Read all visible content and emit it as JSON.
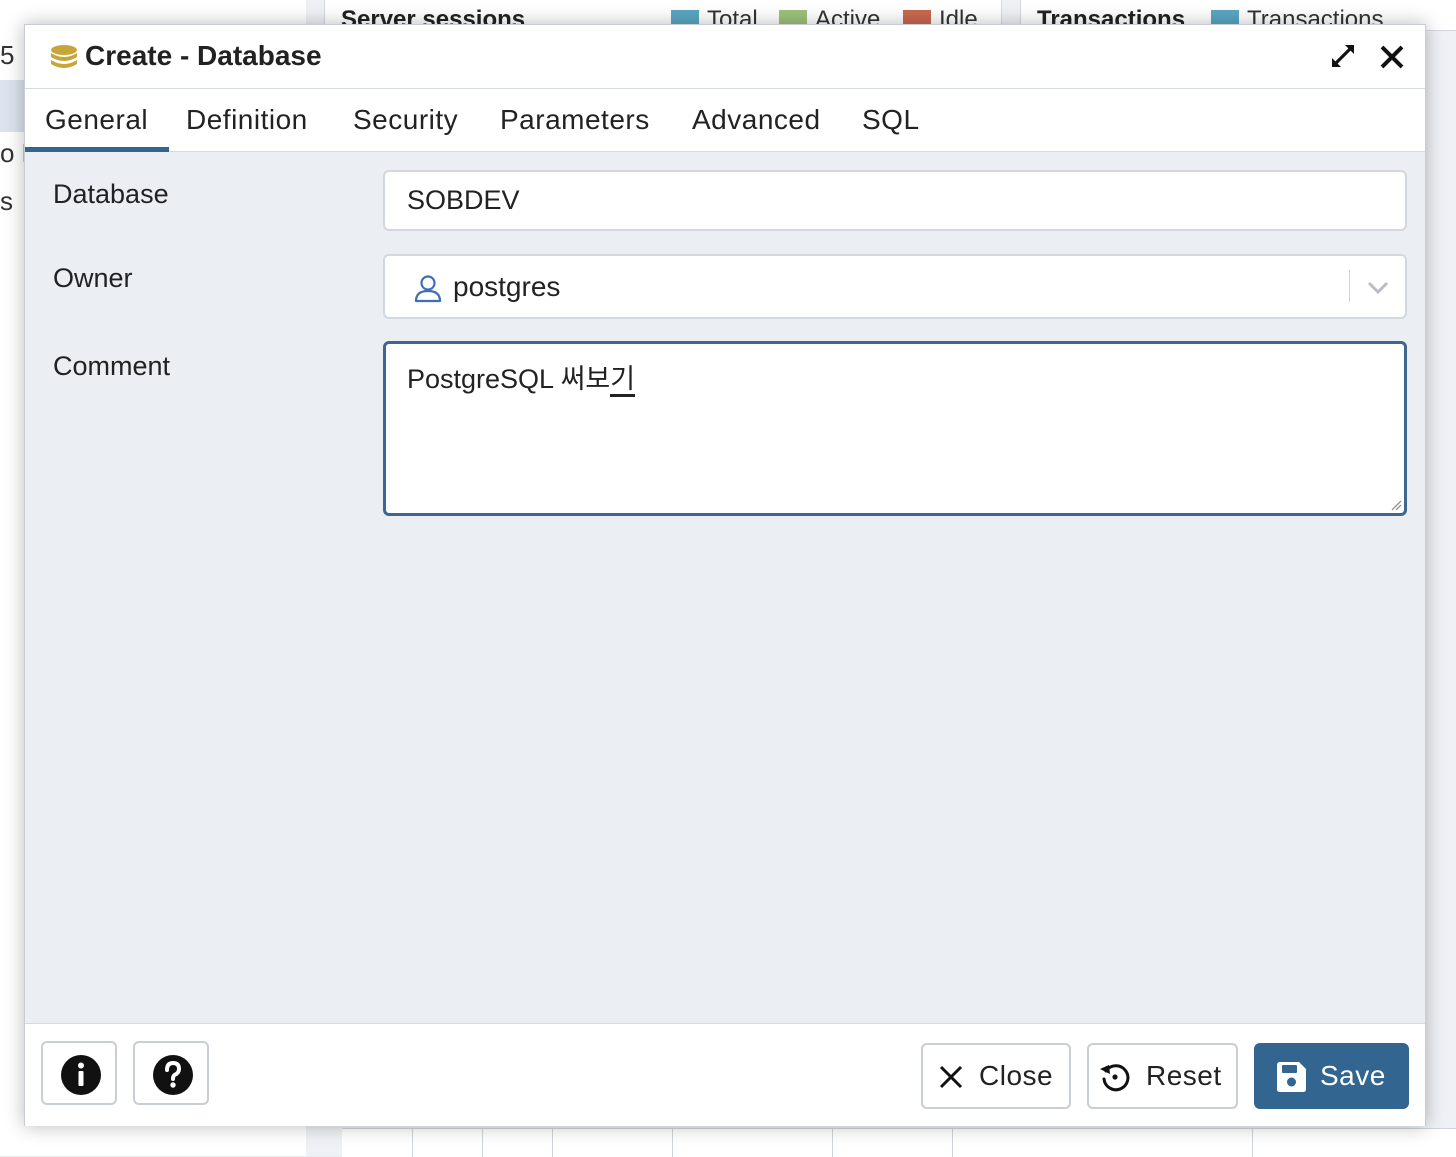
{
  "background": {
    "left_fragments": [
      "5",
      "o F",
      "s"
    ],
    "panel1": {
      "title": "Server sessions",
      "legend": [
        {
          "label": "Total",
          "color": "#5aa6c2"
        },
        {
          "label": "Active",
          "color": "#9dc27b"
        },
        {
          "label": "Idle",
          "color": "#c9694e"
        }
      ]
    },
    "panel2": {
      "title": "Transactions",
      "legend": [
        {
          "label": "Transactions",
          "color": "#5aa6c2"
        }
      ]
    }
  },
  "dialog": {
    "title": "Create - Database",
    "tabs": [
      "General",
      "Definition",
      "Security",
      "Parameters",
      "Advanced",
      "SQL"
    ],
    "active_tab": "General",
    "fields": {
      "database": {
        "label": "Database",
        "value": "SOBDEV"
      },
      "owner": {
        "label": "Owner",
        "value": "postgres"
      },
      "comment": {
        "label": "Comment",
        "value_committed": "PostgreSQL 써보",
        "value_composing": "기"
      }
    },
    "footer": {
      "close_label": "Close",
      "reset_label": "Reset",
      "save_label": "Save"
    },
    "colors": {
      "accent": "#326690",
      "db_icon": "#c7a538"
    }
  }
}
